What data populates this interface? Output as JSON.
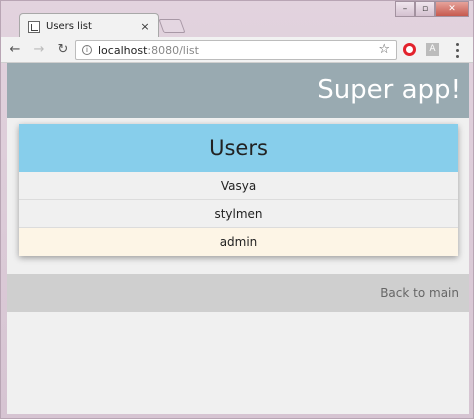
{
  "browser": {
    "tab_title": "Users list",
    "tab_close": "×",
    "url_host": "localhost",
    "url_port_path": ":8080/list",
    "ext_a_label": "A",
    "icons": {
      "back": "arrow-left",
      "forward": "arrow-right",
      "reload": "reload",
      "info": "info",
      "star": "star",
      "opera": "opera",
      "menu": "kebab"
    },
    "window_controls": [
      "–",
      "▫",
      "✕"
    ]
  },
  "app": {
    "title": "Super app!",
    "header_color": "#99aab1",
    "users_header": "Users",
    "users_header_color": "#87ceeb",
    "users": [
      {
        "name": "Vasya"
      },
      {
        "name": "stylmen"
      },
      {
        "name": "admin",
        "highlighted": true
      }
    ],
    "back_link": "Back to main"
  }
}
